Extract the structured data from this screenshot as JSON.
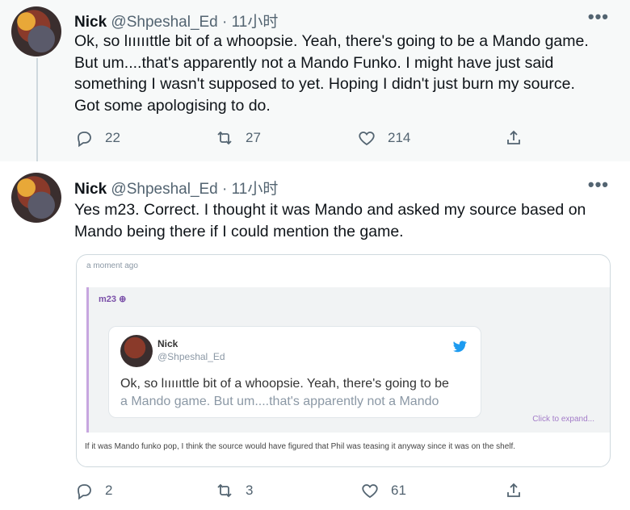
{
  "tweets": [
    {
      "name": "Nick",
      "handle": "@Shpeshal_Ed",
      "time": "· 11小时",
      "more": "•••",
      "lines": [
        "Ok, so lıııııttle bit of a whoopsie. Yeah, there's going to be a Mando game.",
        "But um....that's apparently not a Mando Funko. I might have just said",
        "something I wasn't supposed to yet. Hoping I didn't just burn my source.",
        "Got some apologising to do."
      ],
      "replies": "22",
      "retweets": "27",
      "likes": "214"
    },
    {
      "name": "Nick",
      "handle": "@Shpeshal_Ed",
      "time": "· 11小时",
      "more": "•••",
      "lines": [
        "Yes m23. Correct. I thought it was Mando and asked my source based on",
        "Mando being there if I could mention the game."
      ],
      "replies": "2",
      "retweets": "3",
      "likes": "61"
    }
  ],
  "quote": {
    "meta": "a moment ago",
    "user": "m23 ⊕",
    "embed_name": "Nick",
    "embed_handle": "@Shpeshal_Ed",
    "embed_line1": "Ok, so lıııııttle bit of a whoopsie. Yeah, there's going to be",
    "embed_line2": "a Mando game. But um....that's apparently not a Mando",
    "expand": "Click to expand...",
    "footer": "If it was Mando funko pop, I think the source would have figured that Phil was teasing it anyway since it was on the shelf."
  },
  "colors": {
    "icon": "#536471",
    "twitter_blue": "#1d9bf0",
    "quote_accent": "#c7a6df"
  }
}
